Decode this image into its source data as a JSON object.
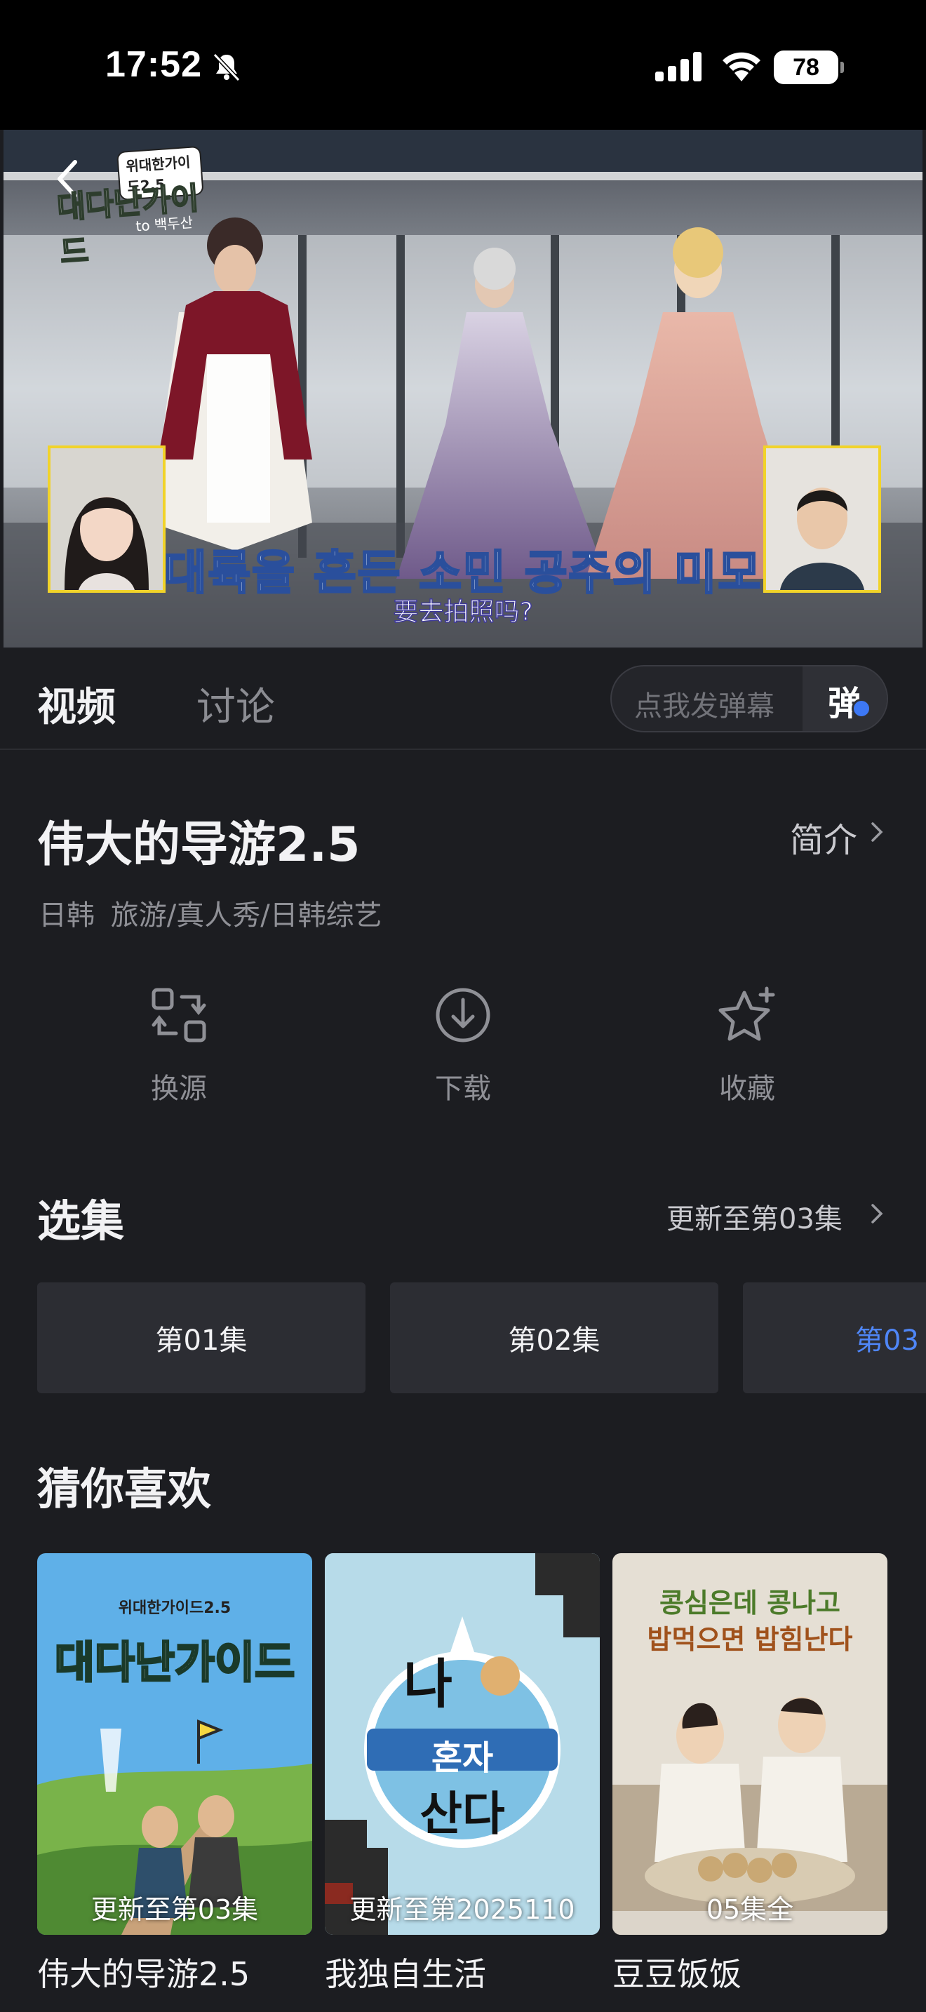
{
  "status_bar": {
    "time": "17:52",
    "battery": "78"
  },
  "player": {
    "logo_line1": "위대한가이드2.5",
    "logo_line2": "대다난가이드",
    "logo_line3": "to 백두산",
    "subtitle_korean": "대륙을 흔든 소민 공주의 미모",
    "subtitle_chinese": "要去拍照吗?"
  },
  "tabs": {
    "video": "视频",
    "discuss": "讨论"
  },
  "danmaku": {
    "placeholder": "点我发弹幕",
    "toggle_label": "弹"
  },
  "show": {
    "title": "伟大的导游2.5",
    "intro_label": "简介",
    "meta": "日韩  旅游/真人秀/日韩综艺"
  },
  "actions": [
    {
      "label": "换源",
      "icon": "switch-source-icon"
    },
    {
      "label": "下载",
      "icon": "download-icon"
    },
    {
      "label": "收藏",
      "icon": "favorite-star-icon"
    }
  ],
  "episodes_section": {
    "title": "选集",
    "update_label": "更新至第03集",
    "items": [
      "第01集",
      "第02集",
      "第03"
    ],
    "active_index": 2,
    "active_color": "#4f86f7"
  },
  "recommend_section": {
    "title": "猜你喜欢",
    "items": [
      {
        "title": "伟大的导游2.5",
        "badge": "更新至第03集",
        "poster_text": "대다난가이드",
        "poster_sub": "위대한가이드2.5"
      },
      {
        "title": "我独自生活",
        "badge": "更新至第2025110",
        "poster_text_1": "나",
        "poster_text_2": "혼자",
        "poster_text_3": "산다"
      },
      {
        "title": "豆豆饭饭",
        "badge": "05集全",
        "poster_text_1": "콩심은데 콩나고",
        "poster_text_2": "밥먹으면 밥힘난다"
      }
    ]
  }
}
